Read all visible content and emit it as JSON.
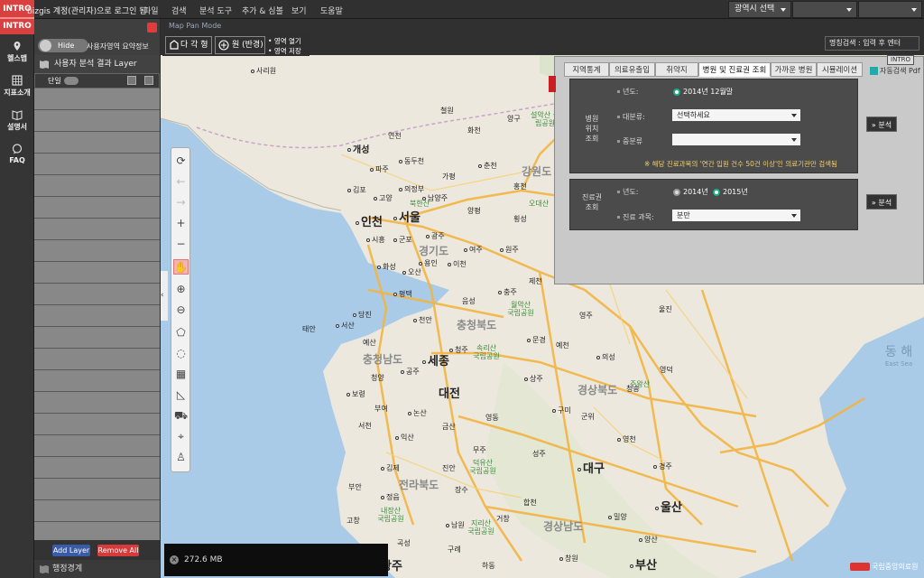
{
  "topbar": {
    "intro": "INTRO",
    "login": "bizgis 계정(관리자)으로 로그인 됨",
    "menus": [
      "파일",
      "검색",
      "분석 도구",
      "추가 & 심볼",
      "보기",
      "도움말"
    ],
    "region_select": "광역시 선택",
    "select2": "",
    "select3": ""
  },
  "nav": {
    "intro": "INTRO",
    "items": [
      "헬스맵",
      "지표소개",
      "설명서",
      "FAQ"
    ]
  },
  "panel": {
    "hide": "Hide",
    "summary": "사용자영역 요약정보",
    "layer_title": "사용자 분석 결과 Layer",
    "layer_row": "단일",
    "add_layer": "Add Layer",
    "remove_all": "Remove All",
    "admin_boundary": "행정경계"
  },
  "map": {
    "mode": "Map Pan Mode",
    "polygon": "다 각 형",
    "circle": "원 (반경)",
    "open_area": "영역 열기",
    "save_area": "영역 저장",
    "search": "명칭검색 : 입력 후 엔터",
    "intro": "INTRO",
    "memory": "272.6 MB",
    "logo": "국립중앙의료원",
    "cities": [
      {
        "t": "사리원",
        "c": "s"
      },
      {
        "t": "개성",
        "c": "m"
      },
      {
        "t": "연천",
        "c": "s"
      },
      {
        "t": "철원",
        "c": "s"
      },
      {
        "t": "양구",
        "c": "s"
      },
      {
        "t": "화천",
        "c": "s"
      },
      {
        "t": "동두천",
        "c": "s"
      },
      {
        "t": "파주",
        "c": "s"
      },
      {
        "t": "가평",
        "c": "s"
      },
      {
        "t": "춘천",
        "c": "s"
      },
      {
        "t": "김포",
        "c": "s"
      },
      {
        "t": "의정부",
        "c": "s"
      },
      {
        "t": "홍천",
        "c": "s"
      },
      {
        "t": "고양",
        "c": "s"
      },
      {
        "t": "남양주",
        "c": "s"
      },
      {
        "t": "인천",
        "c": "b"
      },
      {
        "t": "서울",
        "c": "b"
      },
      {
        "t": "양평",
        "c": "s"
      },
      {
        "t": "횡성",
        "c": "s"
      },
      {
        "t": "시흥",
        "c": "s"
      },
      {
        "t": "군포",
        "c": "s"
      },
      {
        "t": "광주",
        "c": "s"
      },
      {
        "t": "여주",
        "c": "s"
      },
      {
        "t": "원주",
        "c": "s"
      },
      {
        "t": "화성",
        "c": "s"
      },
      {
        "t": "오산",
        "c": "s"
      },
      {
        "t": "용인",
        "c": "s"
      },
      {
        "t": "이천",
        "c": "s"
      },
      {
        "t": "제천",
        "c": "s"
      },
      {
        "t": "평택",
        "c": "s"
      },
      {
        "t": "충주",
        "c": "s"
      },
      {
        "t": "음성",
        "c": "s"
      },
      {
        "t": "당진",
        "c": "s"
      },
      {
        "t": "천안",
        "c": "s"
      },
      {
        "t": "영주",
        "c": "s"
      },
      {
        "t": "울진",
        "c": "s"
      },
      {
        "t": "태안",
        "c": "s"
      },
      {
        "t": "서산",
        "c": "s"
      },
      {
        "t": "예산",
        "c": "s"
      },
      {
        "t": "청주",
        "c": "s"
      },
      {
        "t": "문경",
        "c": "s"
      },
      {
        "t": "예천",
        "c": "s"
      },
      {
        "t": "세종",
        "c": "b"
      },
      {
        "t": "청양",
        "c": "s"
      },
      {
        "t": "공주",
        "c": "s"
      },
      {
        "t": "상주",
        "c": "s"
      },
      {
        "t": "의성",
        "c": "s"
      },
      {
        "t": "영덕",
        "c": "s"
      },
      {
        "t": "보령",
        "c": "s"
      },
      {
        "t": "부여",
        "c": "s"
      },
      {
        "t": "대전",
        "c": "b"
      },
      {
        "t": "청송",
        "c": "s"
      },
      {
        "t": "논산",
        "c": "s"
      },
      {
        "t": "영동",
        "c": "s"
      },
      {
        "t": "구미",
        "c": "s"
      },
      {
        "t": "군위",
        "c": "s"
      },
      {
        "t": "서천",
        "c": "s"
      },
      {
        "t": "익산",
        "c": "s"
      },
      {
        "t": "금산",
        "c": "s"
      },
      {
        "t": "무주",
        "c": "s"
      },
      {
        "t": "영천",
        "c": "s"
      },
      {
        "t": "성주",
        "c": "s"
      },
      {
        "t": "대구",
        "c": "b"
      },
      {
        "t": "경주",
        "c": "s"
      },
      {
        "t": "김제",
        "c": "s"
      },
      {
        "t": "진안",
        "c": "s"
      },
      {
        "t": "부안",
        "c": "s"
      },
      {
        "t": "정읍",
        "c": "s"
      },
      {
        "t": "장수",
        "c": "s"
      },
      {
        "t": "합천",
        "c": "s"
      },
      {
        "t": "울산",
        "c": "b"
      },
      {
        "t": "고창",
        "c": "s"
      },
      {
        "t": "남원",
        "c": "s"
      },
      {
        "t": "밀양",
        "c": "s"
      },
      {
        "t": "거창",
        "c": "s"
      },
      {
        "t": "곡성",
        "c": "s"
      },
      {
        "t": "구례",
        "c": "s"
      },
      {
        "t": "양산",
        "c": "s"
      },
      {
        "t": "광주",
        "c": "b"
      },
      {
        "t": "하동",
        "c": "s"
      },
      {
        "t": "부산",
        "c": "b"
      },
      {
        "t": "창원",
        "c": "s"
      }
    ],
    "provinces": [
      "강원도",
      "경기도",
      "충청북도",
      "충청남도",
      "경상북도",
      "전라북도",
      "경상남도"
    ],
    "parks": [
      "설악산 국립공원",
      "오대산",
      "북한산",
      "월악산 국립공원",
      "속리산 국립공원",
      "덕유산 국립공원",
      "내장산 국립공원",
      "지리산 국립공원",
      "주왕산"
    ],
    "sea": "동 해",
    "sea_en": "East Sea"
  },
  "analysis": {
    "tabs": [
      "지역통계",
      "의료유출입",
      "취약지",
      "병원 및 진료권 조회",
      "가까운 병원",
      "시뮬레이션"
    ],
    "auto_search": "자동검색 Pdf",
    "hospital": {
      "title": "병원 위치 조회",
      "year_label": "년도:",
      "year_value": "2014년 12월말",
      "major_label": "대분류:",
      "major_value": "선택하세요",
      "minor_label": "중분류",
      "minor_value": "",
      "note": "※ 해당 진료과목의 '연간 입원 건수 50건 이상'인 의료기관만 검색됨",
      "btn": "분석"
    },
    "area": {
      "title": "진료권 조회",
      "year_label": "년도:",
      "year1": "2014년",
      "year2": "2015년",
      "dept_label": "진료 과목:",
      "dept_value": "분만",
      "btn": "분석"
    }
  }
}
